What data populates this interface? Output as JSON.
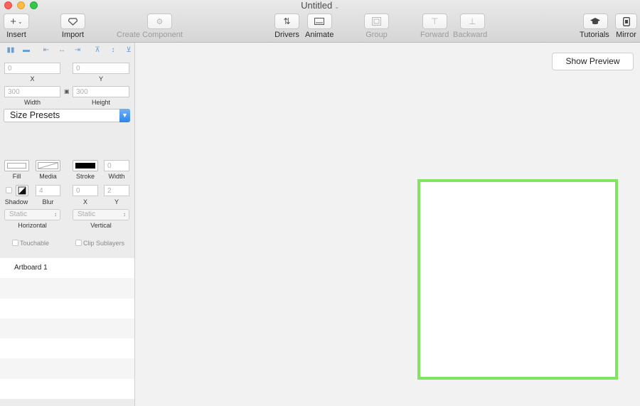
{
  "window": {
    "title": "Untitled"
  },
  "toolbar": {
    "insert": "Insert",
    "import": "Import",
    "create_component": "Create Component",
    "drivers": "Drivers",
    "animate": "Animate",
    "group": "Group",
    "forward": "Forward",
    "backward": "Backward",
    "tutorials": "Tutorials",
    "mirror": "Mirror"
  },
  "inspector": {
    "x_value": "0",
    "x_label": "X",
    "y_value": "0",
    "y_label": "Y",
    "width_value": "300",
    "width_label": "Width",
    "height_value": "300",
    "height_label": "Height",
    "size_presets": "Size Presets",
    "fill_label": "Fill",
    "media_label": "Media",
    "stroke_label": "Stroke",
    "stroke_width_value": "0",
    "stroke_width_label": "Width",
    "shadow_label": "Shadow",
    "blur_value": "4",
    "blur_label": "Blur",
    "shadow_x_value": "0",
    "shadow_x_label": "X",
    "shadow_y_value": "2",
    "shadow_y_label": "Y",
    "horizontal_value": "Static",
    "horizontal_label": "Horizontal",
    "vertical_value": "Static",
    "vertical_label": "Vertical",
    "touchable_label": "Touchable",
    "clip_sublayers_label": "Clip Sublayers"
  },
  "layers": [
    {
      "label": "Artboard 1"
    },
    {
      "label": ""
    },
    {
      "label": ""
    },
    {
      "label": ""
    },
    {
      "label": ""
    },
    {
      "label": ""
    },
    {
      "label": ""
    },
    {
      "label": ""
    }
  ],
  "canvas": {
    "show_preview": "Show Preview",
    "artboard_border_color": "#7fe45f"
  },
  "colors": {
    "accent": "#2f84ea",
    "alignment_icons": "#6b9fd4"
  }
}
